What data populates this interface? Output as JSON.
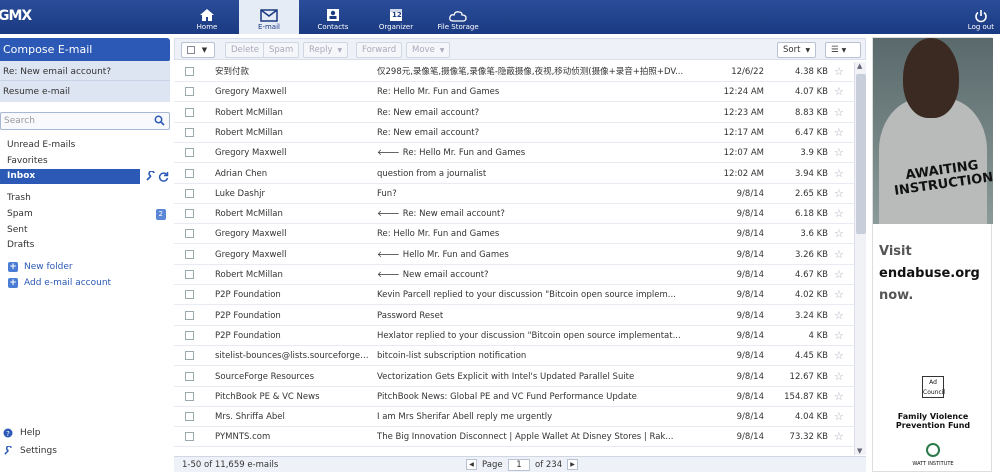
{
  "app": {
    "logo": "GMX"
  },
  "nav": [
    {
      "label": "Home"
    },
    {
      "label": "E-mail"
    },
    {
      "label": "Contacts"
    },
    {
      "label": "Organizer",
      "day": "12"
    },
    {
      "label": "File Storage"
    }
  ],
  "logout_label": "Log out",
  "sidebar": {
    "compose": "Compose E-mail",
    "draft_item": "Re: New email account?",
    "resume": "Resume e-mail",
    "search_placeholder": "Search",
    "folders": [
      {
        "label": "Unread E-mails"
      },
      {
        "label": "Favorites"
      },
      {
        "label": "Inbox"
      },
      {
        "label": "Trash"
      },
      {
        "label": "Spam",
        "count": "2"
      },
      {
        "label": "Sent"
      },
      {
        "label": "Drafts"
      }
    ],
    "new_folder": "New folder",
    "add_account": "Add e-mail account",
    "help": "Help",
    "settings": "Settings"
  },
  "toolbar": {
    "delete": "Delete",
    "spam": "Spam",
    "reply": "Reply",
    "forward": "Forward",
    "move": "Move",
    "sort": "Sort"
  },
  "emails": [
    {
      "from": "安到付款",
      "subject": "仅298元,录像笔,摄像笔,录像笔-隐蔽摄像,夜视,移动侦测(摄像+录音+拍照+DV...",
      "date": "12/6/22",
      "size": "4.38 KB",
      "fwd": false
    },
    {
      "from": "Gregory Maxwell",
      "subject": "Re: Hello Mr. Fun and Games",
      "date": "12:24 AM",
      "size": "4.07 KB",
      "fwd": false
    },
    {
      "from": "Robert McMillan",
      "subject": "Re: New email account?",
      "date": "12:23 AM",
      "size": "8.83 KB",
      "fwd": false
    },
    {
      "from": "Robert McMillan",
      "subject": "Re: New email account?",
      "date": "12:17 AM",
      "size": "6.47 KB",
      "fwd": false
    },
    {
      "from": "Gregory Maxwell",
      "subject": "Re: Hello Mr. Fun and Games",
      "date": "12:07 AM",
      "size": "3.9 KB",
      "fwd": true
    },
    {
      "from": "Adrian Chen",
      "subject": "question from a journalist",
      "date": "12:02 AM",
      "size": "3.94 KB",
      "fwd": false
    },
    {
      "from": "Luke Dashjr",
      "subject": "Fun?",
      "date": "9/8/14",
      "size": "2.65 KB",
      "fwd": false
    },
    {
      "from": "Robert McMillan",
      "subject": "Re: New email account?",
      "date": "9/8/14",
      "size": "6.18 KB",
      "fwd": true
    },
    {
      "from": "Gregory Maxwell",
      "subject": "Re: Hello Mr. Fun and Games",
      "date": "9/8/14",
      "size": "3.6 KB",
      "fwd": false
    },
    {
      "from": "Gregory Maxwell",
      "subject": "Hello Mr. Fun and Games",
      "date": "9/8/14",
      "size": "3.26 KB",
      "fwd": true
    },
    {
      "from": "Robert McMillan",
      "subject": "New email account?",
      "date": "9/8/14",
      "size": "4.67 KB",
      "fwd": true
    },
    {
      "from": "P2P Foundation",
      "subject": "Kevin Parcell replied to your discussion \"Bitcoin open source implem...",
      "date": "9/8/14",
      "size": "4.02 KB",
      "fwd": false
    },
    {
      "from": "P2P Foundation",
      "subject": "Password Reset",
      "date": "9/8/14",
      "size": "3.24 KB",
      "fwd": false
    },
    {
      "from": "P2P Foundation",
      "subject": "Hexlator replied to your discussion \"Bitcoin open source implementat...",
      "date": "9/8/14",
      "size": "4 KB",
      "fwd": false
    },
    {
      "from": "sitelist-bounces@lists.sourceforge....",
      "subject": "bitcoin-list subscription notification",
      "date": "9/8/14",
      "size": "4.45 KB",
      "fwd": false
    },
    {
      "from": "SourceForge Resources",
      "subject": "Vectorization Gets Explicit with Intel's Updated Parallel Suite",
      "date": "9/8/14",
      "size": "12.67 KB",
      "fwd": false
    },
    {
      "from": "PitchBook PE & VC News",
      "subject": "PitchBook News: Global PE and VC Fund Performance Update",
      "date": "9/8/14",
      "size": "154.87 KB",
      "fwd": false
    },
    {
      "from": "Mrs. Shriffa Abel",
      "subject": "I am Mrs Sherifar Abell reply me urgently",
      "date": "9/8/14",
      "size": "4.04 KB",
      "fwd": false
    },
    {
      "from": "PYMNTS.com",
      "subject": "The Big Innovation Disconnect | Apple Wallet At Disney Stores | Rak...",
      "date": "9/8/14",
      "size": "73.32 KB",
      "fwd": false
    }
  ],
  "footer": {
    "count": "1-50 of 11,659 e-mails",
    "page_label": "Page",
    "page_value": "1",
    "of_label": "of 234"
  },
  "ad": {
    "awaiting": "AWAITING INSTRUCTIONS.",
    "visit": "Visit",
    "site": "endabuse.org",
    "now": "now.",
    "council": "Ad Council",
    "fund": "Family Violence Prevention Fund",
    "institute": "WATT INSTITUTE"
  }
}
